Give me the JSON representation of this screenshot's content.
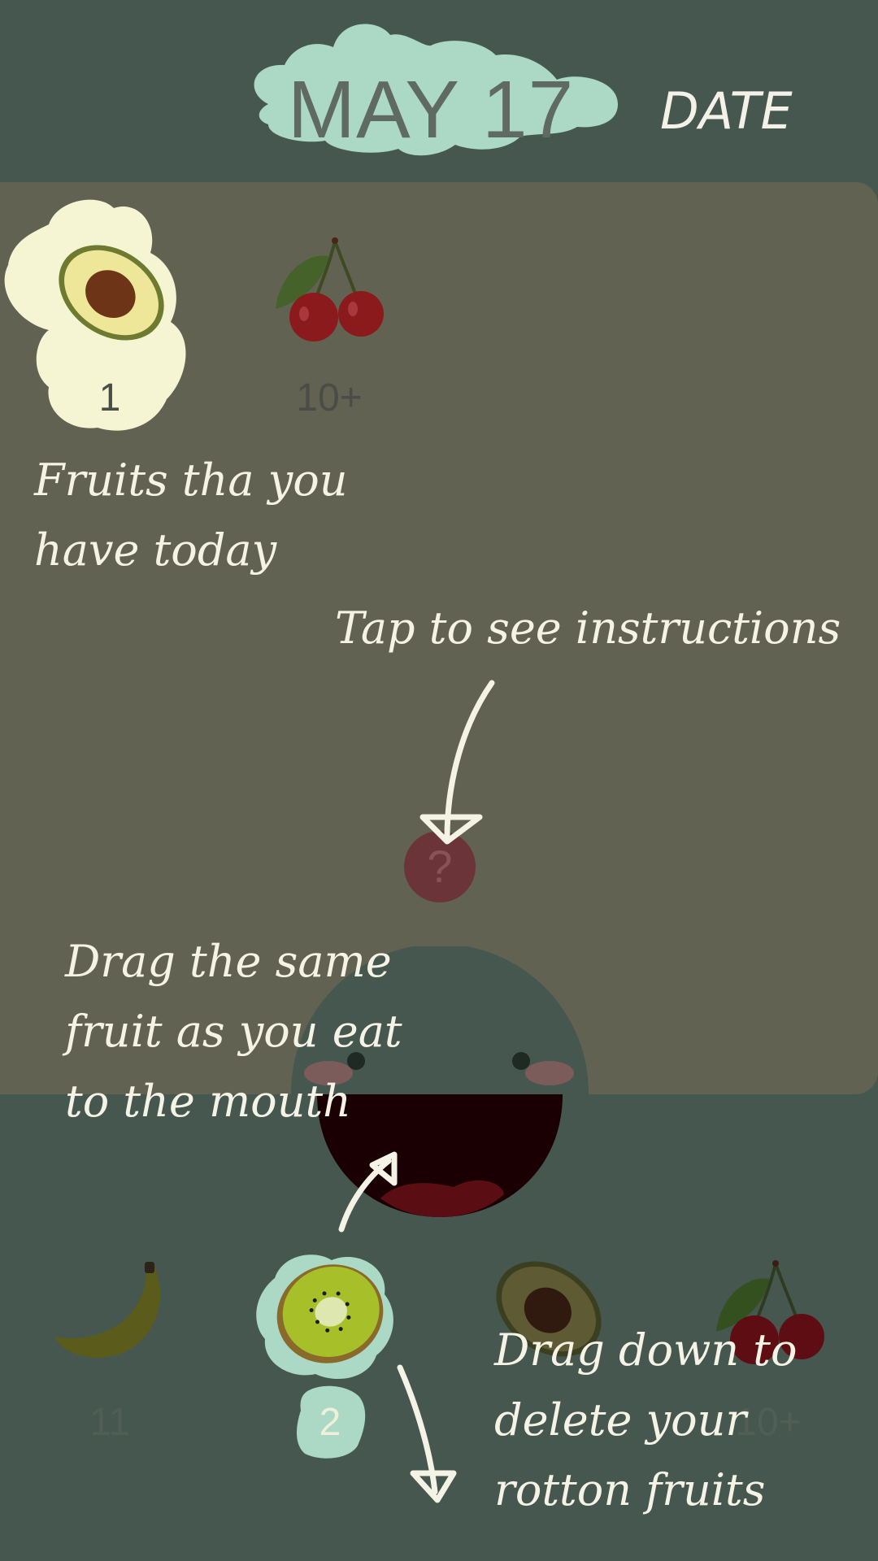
{
  "header": {
    "date": "MAY 17",
    "date_label": "DATE"
  },
  "today_fruits": [
    {
      "name": "avocado",
      "count": "1",
      "icon": "avocado-icon",
      "selected": true
    },
    {
      "name": "cherry",
      "count": "10+",
      "icon": "cherry-icon",
      "selected": false
    }
  ],
  "instructions": {
    "fruits_today": [
      "Fruits tha you",
      "have today"
    ],
    "tap_help": "Tap to see instructions",
    "drag_mouth": [
      "Drag the same",
      "fruit as you eat",
      "to the mouth"
    ],
    "drag_delete": [
      "Drag down to",
      "delete your",
      "rotton fruits"
    ]
  },
  "help_button": {
    "label": "?"
  },
  "basket": [
    {
      "name": "banana",
      "count": "11",
      "icon": "banana-icon"
    },
    {
      "name": "kiwi",
      "count": "2",
      "icon": "kiwi-icon",
      "selected": true
    },
    {
      "name": "avocado",
      "count": "",
      "icon": "avocado-icon"
    },
    {
      "name": "cherry",
      "count": "10+",
      "icon": "cherry-icon"
    }
  ],
  "colors": {
    "background": "#46574f",
    "panel": "#626252",
    "accent_mint": "#aad8c4",
    "highlight_cream": "#f5f5d3",
    "mouth": "#1a0002",
    "help_button": "#6a3438"
  }
}
